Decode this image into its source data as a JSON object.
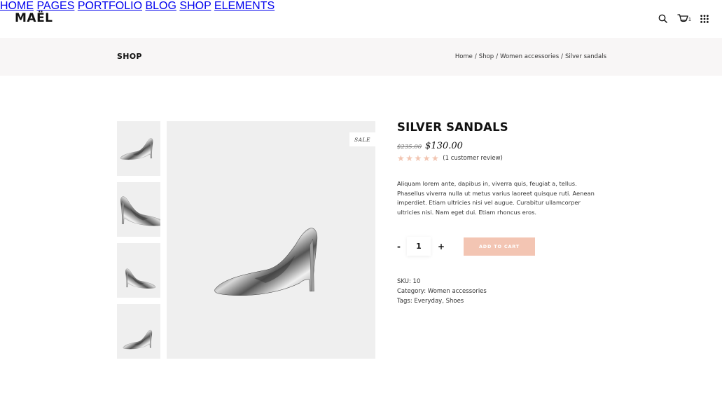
{
  "header": {
    "logo": "MAËL",
    "nav": [
      {
        "label": "HOME"
      },
      {
        "label": "PAGES"
      },
      {
        "label": "PORTFOLIO"
      },
      {
        "label": "BLOG"
      },
      {
        "label": "SHOP"
      },
      {
        "label": "ELEMENTS"
      }
    ],
    "icons": {
      "search": "search-icon",
      "cart": "cart-icon",
      "menu": "grid-menu-icon"
    },
    "cart_count": "1"
  },
  "title_bar": {
    "title": "SHOP",
    "breadcrumb": [
      "Home",
      "Shop",
      "Women accessories",
      "Silver sandals"
    ],
    "separator": "/"
  },
  "gallery": {
    "thumbnails": [
      "thumbnail-1",
      "thumbnail-2",
      "thumbnail-3",
      "thumbnail-4"
    ],
    "badge": "SALE"
  },
  "product": {
    "title": "SILVER SANDALS",
    "old_price": "$235.00",
    "price": "$130.00",
    "stars": "★★★★★",
    "rating": 5,
    "review_text": "(1 customer review)",
    "description": "Aliquam lorem ante, dapibus in, viverra quis, feugiat a, tellus. Phasellus viverra nulla ut metus varius laoreet quisque ruti. Aenean imperdiet. Etiam ultricies nisi vel augue. Curabitur ullamcorper ultricies nisi. Nam eget dui. Etiam rhoncus eros.",
    "qty_minus": "-",
    "qty_plus": "+",
    "quantity": "1",
    "add_to_cart": "ADD TO CART",
    "sku_label": "SKU:",
    "sku": "10",
    "category_label": "Category:",
    "category": "Women accessories",
    "tags_label": "Tags:",
    "tags": [
      "Everyday",
      "Shoes"
    ]
  },
  "colors": {
    "accent": "#f3c5b3",
    "title_bar_bg": "#f8f6f6",
    "image_bg": "#efefef"
  }
}
